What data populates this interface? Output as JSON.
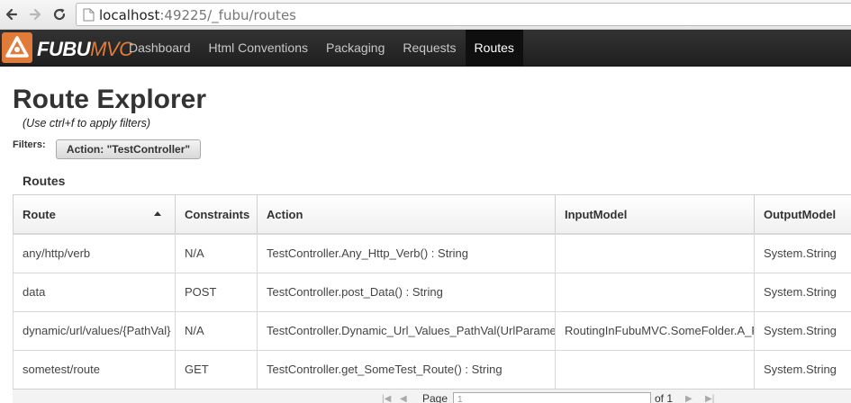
{
  "browser": {
    "url_host": "localhost",
    "url_rest": ":49225/_fubu/routes"
  },
  "app": {
    "logo_fubu": "FUBU",
    "logo_mvc": "MVC",
    "nav": [
      {
        "label": "Dashboard"
      },
      {
        "label": "Html Conventions"
      },
      {
        "label": "Packaging"
      },
      {
        "label": "Requests"
      },
      {
        "label": "Routes",
        "active": true
      }
    ]
  },
  "page": {
    "title": "Route Explorer",
    "subtitle": "(Use ctrl+f to apply filters)",
    "filters_label": "Filters:",
    "filter_chip": "Action: \"TestController\"",
    "section_title": "Routes"
  },
  "table": {
    "columns": [
      "Route",
      "Constraints",
      "Action",
      "InputModel",
      "OutputModel"
    ],
    "sorted_column": "Route",
    "sort_direction": "ascending",
    "rows": [
      {
        "route": "any/http/verb",
        "constraints": "N/A",
        "action": "TestController.Any_Http_Verb() : String",
        "input": "",
        "output": "System.String"
      },
      {
        "route": "data",
        "constraints": "POST",
        "action": "TestController.post_Data() : String",
        "input": "",
        "output": "System.String"
      },
      {
        "route": "dynamic/url/values/{PathVal}",
        "constraints": "N/A",
        "action": "TestController.Dynamic_Url_Values_PathVal(UrlParame",
        "input": "RoutingInFubuMVC.SomeFolder.A_F",
        "output": "System.String"
      },
      {
        "route": "sometest/route",
        "constraints": "GET",
        "action": "TestController.get_SomeTest_Route() : String",
        "input": "",
        "output": "System.String"
      }
    ]
  },
  "pager": {
    "page_label": "Page",
    "page_value": "1",
    "of_label": "of 1"
  },
  "colors": {
    "navbar": "#222222",
    "logo_accent": "#e07b39",
    "text": "#333333"
  }
}
